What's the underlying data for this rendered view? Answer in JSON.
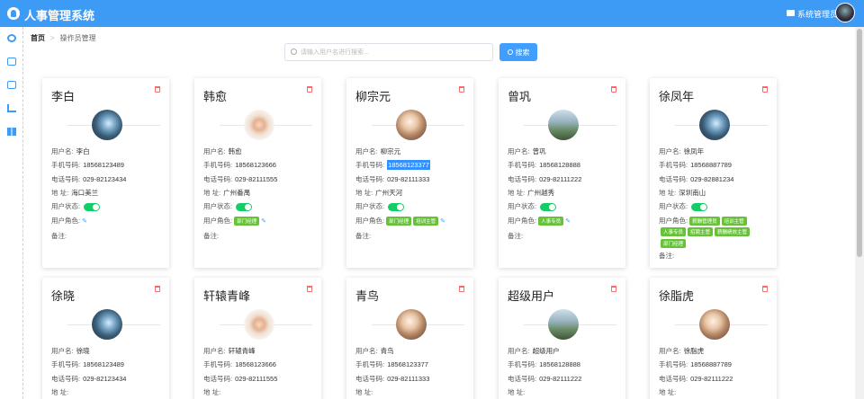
{
  "app": {
    "title": "人事管理系统",
    "admin_name": "系统管理员"
  },
  "sidebar": {
    "items": [
      "user-icon",
      "id-card-icon",
      "camera-icon",
      "chart-icon",
      "windows-icon"
    ]
  },
  "breadcrumb": {
    "home": "首页",
    "current": "操作员管理"
  },
  "search": {
    "placeholder": "请输入用户名进行搜索...",
    "value": "",
    "button_label": "搜索"
  },
  "labels": {
    "username": "用户名:",
    "phone": "手机号码:",
    "tel": "电话号码:",
    "address": "地 址:",
    "status": "用户状态:",
    "roles": "用户角色:",
    "remark": "备注:"
  },
  "cards": [
    {
      "name": "李白",
      "username": "李白",
      "phone": "18568123489",
      "tel": "029-82123434",
      "address": "海口美兰",
      "enabled": true,
      "roles": [],
      "avatar": "dark-night",
      "phone_selected": false
    },
    {
      "name": "韩愈",
      "username": "韩愈",
      "phone": "18568123666",
      "tel": "029-82111555",
      "address": "广州番禺",
      "enabled": true,
      "roles": [
        "部门经理"
      ],
      "avatar": "girl-flower",
      "phone_selected": false
    },
    {
      "name": "柳宗元",
      "username": "柳宗元",
      "phone": "18568123377",
      "tel": "029-82111333",
      "address": "广州天河",
      "enabled": true,
      "roles": [
        "部门经理",
        "培训主管"
      ],
      "avatar": "girl-portrait",
      "phone_selected": true
    },
    {
      "name": "曾巩",
      "username": "曾巩",
      "phone": "18568128888",
      "tel": "029-82111222",
      "address": "广州越秀",
      "enabled": true,
      "roles": [
        "人事专员"
      ],
      "avatar": "mountain",
      "phone_selected": false
    },
    {
      "name": "徐凤年",
      "username": "徐凤年",
      "phone": "18568887789",
      "tel": "029-82881234",
      "address": "深圳南山",
      "enabled": true,
      "roles": [
        "薪酬管理员",
        "培训主管",
        "人事专员",
        "招聘主管",
        "薪酬绩效主管",
        "部门经理"
      ],
      "avatar": "dark-night",
      "phone_selected": false
    },
    {
      "name": "徐晓",
      "username": "徐晓",
      "phone": "18568123489",
      "tel": "029-82123434",
      "address": "",
      "enabled": true,
      "roles": [],
      "avatar": "dark-night",
      "phone_selected": false
    },
    {
      "name": "轩辕青峰",
      "username": "轩辕青峰",
      "phone": "18568123666",
      "tel": "029-82111555",
      "address": "",
      "enabled": true,
      "roles": [],
      "avatar": "girl-flower",
      "phone_selected": false
    },
    {
      "name": "青鸟",
      "username": "青鸟",
      "phone": "18568123377",
      "tel": "029-82111333",
      "address": "",
      "enabled": true,
      "roles": [],
      "avatar": "girl-portrait",
      "phone_selected": false
    },
    {
      "name": "超级用户",
      "username": "超级用户",
      "phone": "18568128888",
      "tel": "029-82111222",
      "address": "",
      "enabled": true,
      "roles": [],
      "avatar": "mountain",
      "phone_selected": false
    },
    {
      "name": "徐脂虎",
      "username": "徐脂虎",
      "phone": "18568887789",
      "tel": "029-82111222",
      "address": "",
      "enabled": true,
      "roles": [],
      "avatar": "girl-portrait",
      "phone_selected": false
    }
  ]
}
